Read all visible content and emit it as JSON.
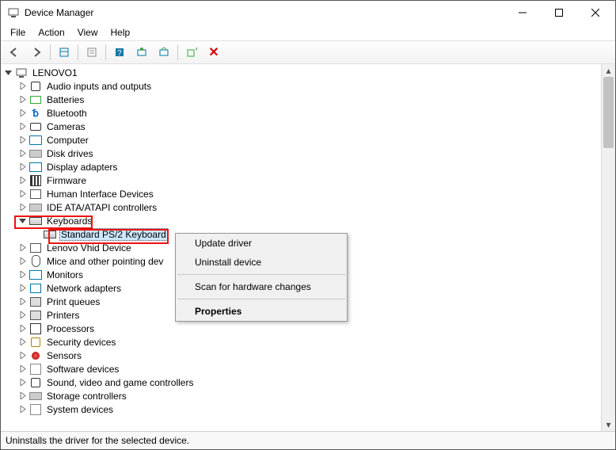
{
  "window": {
    "title": "Device Manager"
  },
  "menu": {
    "file": "File",
    "action": "Action",
    "view": "View",
    "help": "Help"
  },
  "toolbar_icons": [
    "back",
    "forward",
    "show-hidden",
    "properties",
    "help",
    "update",
    "scan",
    "add-legacy",
    "uninstall"
  ],
  "tree": {
    "root": {
      "label": "LENOVO1",
      "expanded": true
    },
    "children": [
      {
        "label": "Audio inputs and outputs",
        "icon": "speaker",
        "expanded": false
      },
      {
        "label": "Batteries",
        "icon": "battery",
        "expanded": false
      },
      {
        "label": "Bluetooth",
        "icon": "bluetooth",
        "expanded": false
      },
      {
        "label": "Cameras",
        "icon": "camera",
        "expanded": false
      },
      {
        "label": "Computer",
        "icon": "computer",
        "expanded": false
      },
      {
        "label": "Disk drives",
        "icon": "drive",
        "expanded": false
      },
      {
        "label": "Display adapters",
        "icon": "display",
        "expanded": false
      },
      {
        "label": "Firmware",
        "icon": "chip",
        "expanded": false
      },
      {
        "label": "Human Interface Devices",
        "icon": "hid",
        "expanded": false
      },
      {
        "label": "IDE ATA/ATAPI controllers",
        "icon": "drive",
        "expanded": false
      },
      {
        "label": "Keyboards",
        "icon": "keyboard",
        "expanded": true,
        "children": [
          {
            "label": "Standard PS/2 Keyboard",
            "icon": "keyboard",
            "selected": true
          }
        ]
      },
      {
        "label": "Lenovo Vhid Device",
        "icon": "hid",
        "expanded": false
      },
      {
        "label": "Mice and other pointing devices",
        "icon": "mouse",
        "expanded": false,
        "truncated": true
      },
      {
        "label": "Monitors",
        "icon": "display",
        "expanded": false
      },
      {
        "label": "Network adapters",
        "icon": "network",
        "expanded": false
      },
      {
        "label": "Print queues",
        "icon": "printer",
        "expanded": false
      },
      {
        "label": "Printers",
        "icon": "printer",
        "expanded": false
      },
      {
        "label": "Processors",
        "icon": "cpu",
        "expanded": false
      },
      {
        "label": "Security devices",
        "icon": "lock",
        "expanded": false
      },
      {
        "label": "Sensors",
        "icon": "sensor",
        "expanded": false
      },
      {
        "label": "Software devices",
        "icon": "system",
        "expanded": false
      },
      {
        "label": "Sound, video and game controllers",
        "icon": "speaker",
        "expanded": false
      },
      {
        "label": "Storage controllers",
        "icon": "drive",
        "expanded": false
      },
      {
        "label": "System devices",
        "icon": "system",
        "expanded": false,
        "truncated_row": true
      }
    ]
  },
  "context_menu": {
    "items": [
      {
        "label": "Update driver",
        "kind": "item"
      },
      {
        "label": "Uninstall device",
        "kind": "item"
      },
      {
        "kind": "sep"
      },
      {
        "label": "Scan for hardware changes",
        "kind": "item"
      },
      {
        "kind": "sep"
      },
      {
        "label": "Properties",
        "kind": "item",
        "bold": true
      }
    ]
  },
  "statusbar": {
    "text": "Uninstalls the driver for the selected device."
  }
}
